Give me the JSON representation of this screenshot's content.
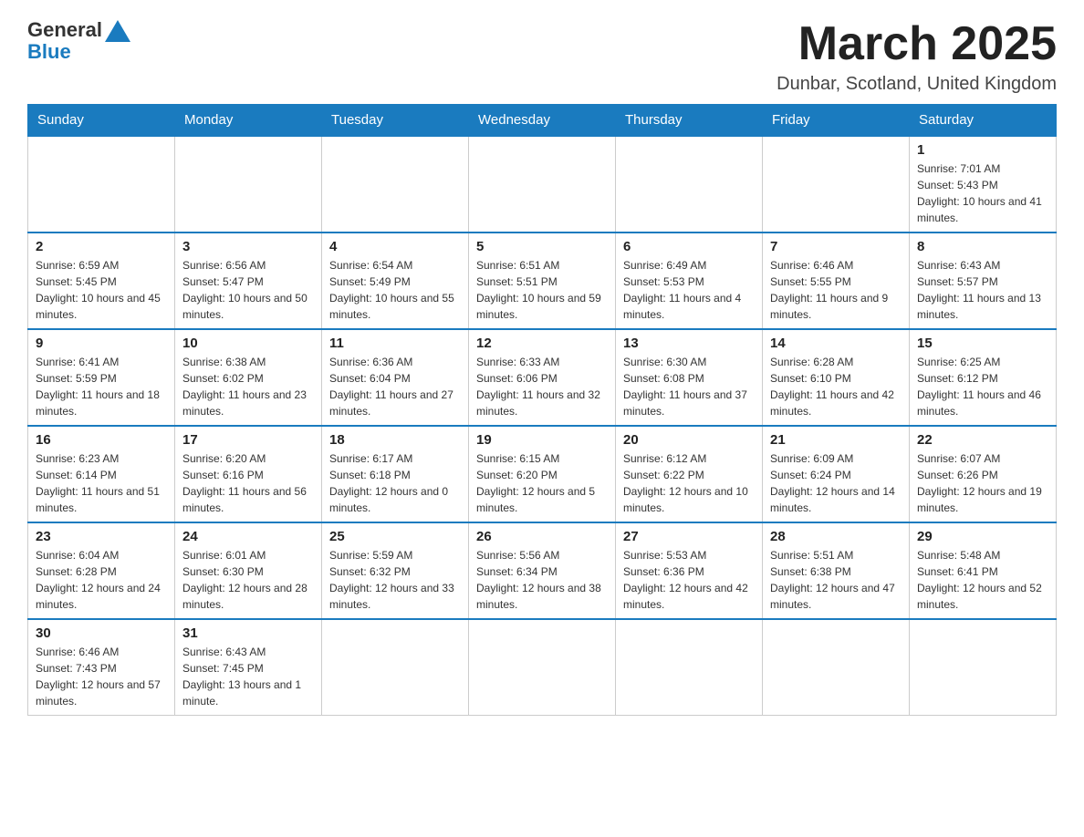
{
  "logo": {
    "general": "General",
    "blue": "Blue"
  },
  "header": {
    "month_title": "March 2025",
    "location": "Dunbar, Scotland, United Kingdom"
  },
  "weekdays": [
    "Sunday",
    "Monday",
    "Tuesday",
    "Wednesday",
    "Thursday",
    "Friday",
    "Saturday"
  ],
  "weeks": [
    [
      {
        "day": "",
        "info": ""
      },
      {
        "day": "",
        "info": ""
      },
      {
        "day": "",
        "info": ""
      },
      {
        "day": "",
        "info": ""
      },
      {
        "day": "",
        "info": ""
      },
      {
        "day": "",
        "info": ""
      },
      {
        "day": "1",
        "info": "Sunrise: 7:01 AM\nSunset: 5:43 PM\nDaylight: 10 hours and 41 minutes."
      }
    ],
    [
      {
        "day": "2",
        "info": "Sunrise: 6:59 AM\nSunset: 5:45 PM\nDaylight: 10 hours and 45 minutes."
      },
      {
        "day": "3",
        "info": "Sunrise: 6:56 AM\nSunset: 5:47 PM\nDaylight: 10 hours and 50 minutes."
      },
      {
        "day": "4",
        "info": "Sunrise: 6:54 AM\nSunset: 5:49 PM\nDaylight: 10 hours and 55 minutes."
      },
      {
        "day": "5",
        "info": "Sunrise: 6:51 AM\nSunset: 5:51 PM\nDaylight: 10 hours and 59 minutes."
      },
      {
        "day": "6",
        "info": "Sunrise: 6:49 AM\nSunset: 5:53 PM\nDaylight: 11 hours and 4 minutes."
      },
      {
        "day": "7",
        "info": "Sunrise: 6:46 AM\nSunset: 5:55 PM\nDaylight: 11 hours and 9 minutes."
      },
      {
        "day": "8",
        "info": "Sunrise: 6:43 AM\nSunset: 5:57 PM\nDaylight: 11 hours and 13 minutes."
      }
    ],
    [
      {
        "day": "9",
        "info": "Sunrise: 6:41 AM\nSunset: 5:59 PM\nDaylight: 11 hours and 18 minutes."
      },
      {
        "day": "10",
        "info": "Sunrise: 6:38 AM\nSunset: 6:02 PM\nDaylight: 11 hours and 23 minutes."
      },
      {
        "day": "11",
        "info": "Sunrise: 6:36 AM\nSunset: 6:04 PM\nDaylight: 11 hours and 27 minutes."
      },
      {
        "day": "12",
        "info": "Sunrise: 6:33 AM\nSunset: 6:06 PM\nDaylight: 11 hours and 32 minutes."
      },
      {
        "day": "13",
        "info": "Sunrise: 6:30 AM\nSunset: 6:08 PM\nDaylight: 11 hours and 37 minutes."
      },
      {
        "day": "14",
        "info": "Sunrise: 6:28 AM\nSunset: 6:10 PM\nDaylight: 11 hours and 42 minutes."
      },
      {
        "day": "15",
        "info": "Sunrise: 6:25 AM\nSunset: 6:12 PM\nDaylight: 11 hours and 46 minutes."
      }
    ],
    [
      {
        "day": "16",
        "info": "Sunrise: 6:23 AM\nSunset: 6:14 PM\nDaylight: 11 hours and 51 minutes."
      },
      {
        "day": "17",
        "info": "Sunrise: 6:20 AM\nSunset: 6:16 PM\nDaylight: 11 hours and 56 minutes."
      },
      {
        "day": "18",
        "info": "Sunrise: 6:17 AM\nSunset: 6:18 PM\nDaylight: 12 hours and 0 minutes."
      },
      {
        "day": "19",
        "info": "Sunrise: 6:15 AM\nSunset: 6:20 PM\nDaylight: 12 hours and 5 minutes."
      },
      {
        "day": "20",
        "info": "Sunrise: 6:12 AM\nSunset: 6:22 PM\nDaylight: 12 hours and 10 minutes."
      },
      {
        "day": "21",
        "info": "Sunrise: 6:09 AM\nSunset: 6:24 PM\nDaylight: 12 hours and 14 minutes."
      },
      {
        "day": "22",
        "info": "Sunrise: 6:07 AM\nSunset: 6:26 PM\nDaylight: 12 hours and 19 minutes."
      }
    ],
    [
      {
        "day": "23",
        "info": "Sunrise: 6:04 AM\nSunset: 6:28 PM\nDaylight: 12 hours and 24 minutes."
      },
      {
        "day": "24",
        "info": "Sunrise: 6:01 AM\nSunset: 6:30 PM\nDaylight: 12 hours and 28 minutes."
      },
      {
        "day": "25",
        "info": "Sunrise: 5:59 AM\nSunset: 6:32 PM\nDaylight: 12 hours and 33 minutes."
      },
      {
        "day": "26",
        "info": "Sunrise: 5:56 AM\nSunset: 6:34 PM\nDaylight: 12 hours and 38 minutes."
      },
      {
        "day": "27",
        "info": "Sunrise: 5:53 AM\nSunset: 6:36 PM\nDaylight: 12 hours and 42 minutes."
      },
      {
        "day": "28",
        "info": "Sunrise: 5:51 AM\nSunset: 6:38 PM\nDaylight: 12 hours and 47 minutes."
      },
      {
        "day": "29",
        "info": "Sunrise: 5:48 AM\nSunset: 6:41 PM\nDaylight: 12 hours and 52 minutes."
      }
    ],
    [
      {
        "day": "30",
        "info": "Sunrise: 6:46 AM\nSunset: 7:43 PM\nDaylight: 12 hours and 57 minutes."
      },
      {
        "day": "31",
        "info": "Sunrise: 6:43 AM\nSunset: 7:45 PM\nDaylight: 13 hours and 1 minute."
      },
      {
        "day": "",
        "info": ""
      },
      {
        "day": "",
        "info": ""
      },
      {
        "day": "",
        "info": ""
      },
      {
        "day": "",
        "info": ""
      },
      {
        "day": "",
        "info": ""
      }
    ]
  ]
}
